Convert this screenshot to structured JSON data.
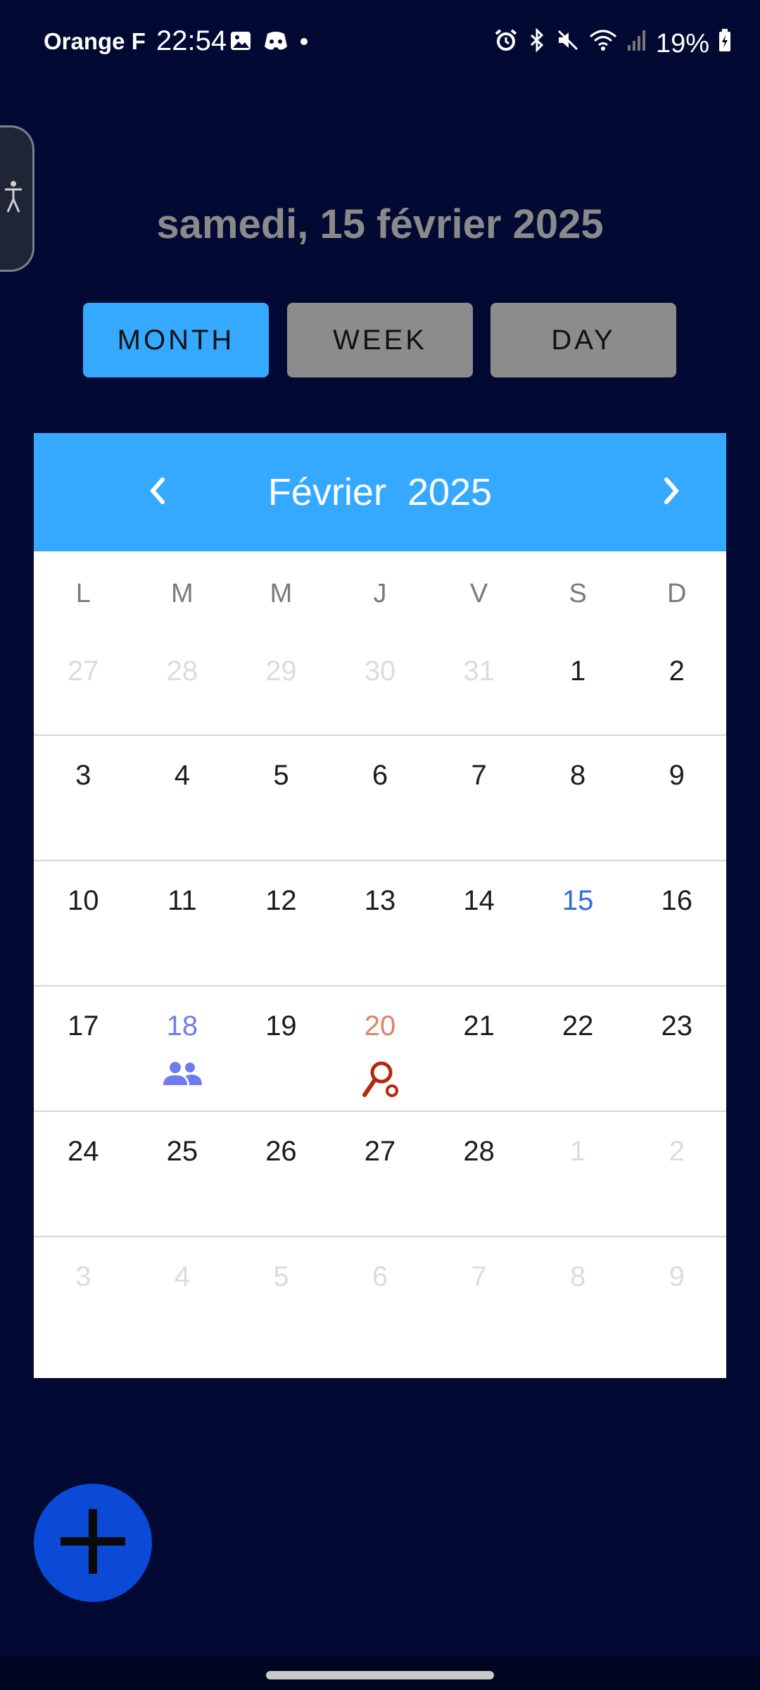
{
  "status_bar": {
    "carrier": "Orange F",
    "time": "22:54",
    "battery": "19%",
    "left_icons": [
      "image-icon",
      "discord-icon",
      "dot-icon"
    ],
    "right_icons": [
      "alarm-icon",
      "bluetooth-icon",
      "mute-icon",
      "wifi-icon",
      "signal-icon",
      "battery-icon"
    ]
  },
  "header": {
    "date_title": "samedi, 15 février 2025"
  },
  "view_switch": {
    "month": "MONTH",
    "week": "WEEK",
    "day": "DAY",
    "active": "month"
  },
  "calendar": {
    "month_label": "Février  2025",
    "weekdays": [
      "L",
      "M",
      "M",
      "J",
      "V",
      "S",
      "D"
    ],
    "weeks": [
      [
        "27",
        "28",
        "29",
        "30",
        "31",
        "1",
        "2"
      ],
      [
        "3",
        "4",
        "5",
        "6",
        "7",
        "8",
        "9"
      ],
      [
        "10",
        "11",
        "12",
        "13",
        "14",
        "15",
        "16"
      ],
      [
        "17",
        "18",
        "19",
        "20",
        "21",
        "22",
        "23"
      ],
      [
        "24",
        "25",
        "26",
        "27",
        "28",
        "1",
        "2"
      ],
      [
        "3",
        "4",
        "5",
        "6",
        "7",
        "8",
        "9"
      ]
    ],
    "today": "15",
    "events": [
      {
        "day": "18",
        "icon": "group-icon",
        "color": "#6f7cf0"
      },
      {
        "day": "20",
        "icon": "racket-icon",
        "color": "#b5280f"
      }
    ]
  },
  "colors": {
    "background": "#020933",
    "accent": "#35a9ff",
    "today": "#2f6be8",
    "fab": "#0a4ad6"
  },
  "fab": {
    "icon": "plus-icon"
  }
}
